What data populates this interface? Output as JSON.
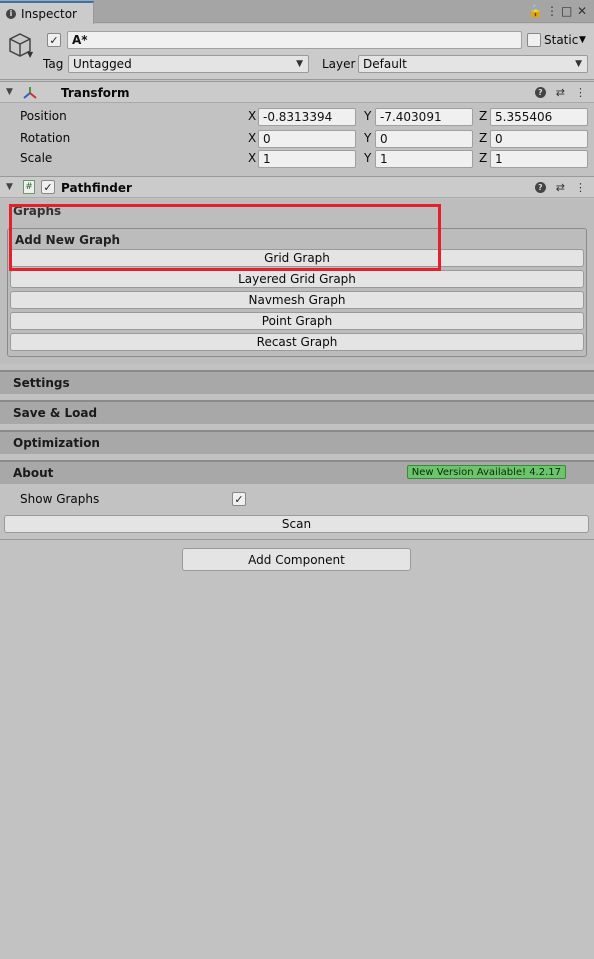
{
  "tab": {
    "label": "Inspector"
  },
  "object": {
    "name": "A*",
    "static_label": "Static",
    "tag_label": "Tag",
    "tag_value": "Untagged",
    "layer_label": "Layer",
    "layer_value": "Default"
  },
  "transform": {
    "title": "Transform",
    "rows": [
      {
        "label": "Position",
        "x": "-0.8313394",
        "y": "-7.403091",
        "z": "5.355406"
      },
      {
        "label": "Rotation",
        "x": "0",
        "y": "0",
        "z": "0"
      },
      {
        "label": "Scale",
        "x": "1",
        "y": "1",
        "z": "1"
      }
    ],
    "axes": {
      "x": "X",
      "y": "Y",
      "z": "Z"
    }
  },
  "pathfinder": {
    "title": "Pathfinder",
    "script_icon": "#",
    "graphs_label": "Graphs",
    "add_new_graph_label": "Add New Graph",
    "graph_buttons": [
      "Grid Graph",
      "Layered Grid Graph",
      "Navmesh Graph",
      "Point Graph",
      "Recast Graph"
    ],
    "sections": [
      "Settings",
      "Save & Load",
      "Optimization",
      "About"
    ],
    "new_version": "New Version Available! 4.2.17",
    "show_graphs_label": "Show Graphs",
    "scan_label": "Scan"
  },
  "add_component_label": "Add Component",
  "colors": {
    "highlight_box": "#e5202a",
    "badge": "#6cc56c",
    "tab_accent": "#3a72b0"
  }
}
